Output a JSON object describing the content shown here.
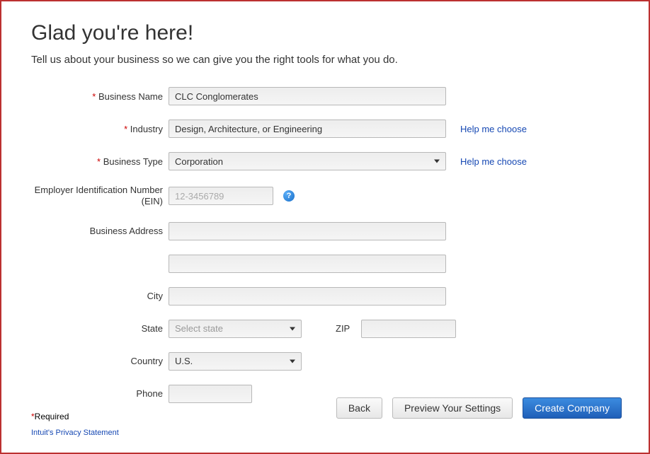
{
  "header": {
    "title": "Glad you're here!",
    "subtitle": "Tell us about your business so we can give you the right tools for what you do."
  },
  "labels": {
    "business_name": "Business Name",
    "industry": "Industry",
    "business_type": "Business Type",
    "ein": "Employer Identification Number (EIN)",
    "business_address": "Business Address",
    "city": "City",
    "state": "State",
    "zip": "ZIP",
    "country": "Country",
    "phone": "Phone"
  },
  "values": {
    "business_name": "CLC Conglomerates",
    "industry": "Design, Architecture, or Engineering",
    "business_type": "Corporation",
    "ein": "",
    "business_address1": "",
    "business_address2": "",
    "city": "",
    "state": "Select state",
    "zip": "",
    "country": "U.S.",
    "phone": ""
  },
  "placeholders": {
    "ein": "12-3456789"
  },
  "links": {
    "help_me_choose": "Help me choose",
    "privacy": "Intuit's Privacy Statement"
  },
  "footer": {
    "required_text": "Required",
    "back": "Back",
    "preview": "Preview Your Settings",
    "create": "Create Company"
  }
}
